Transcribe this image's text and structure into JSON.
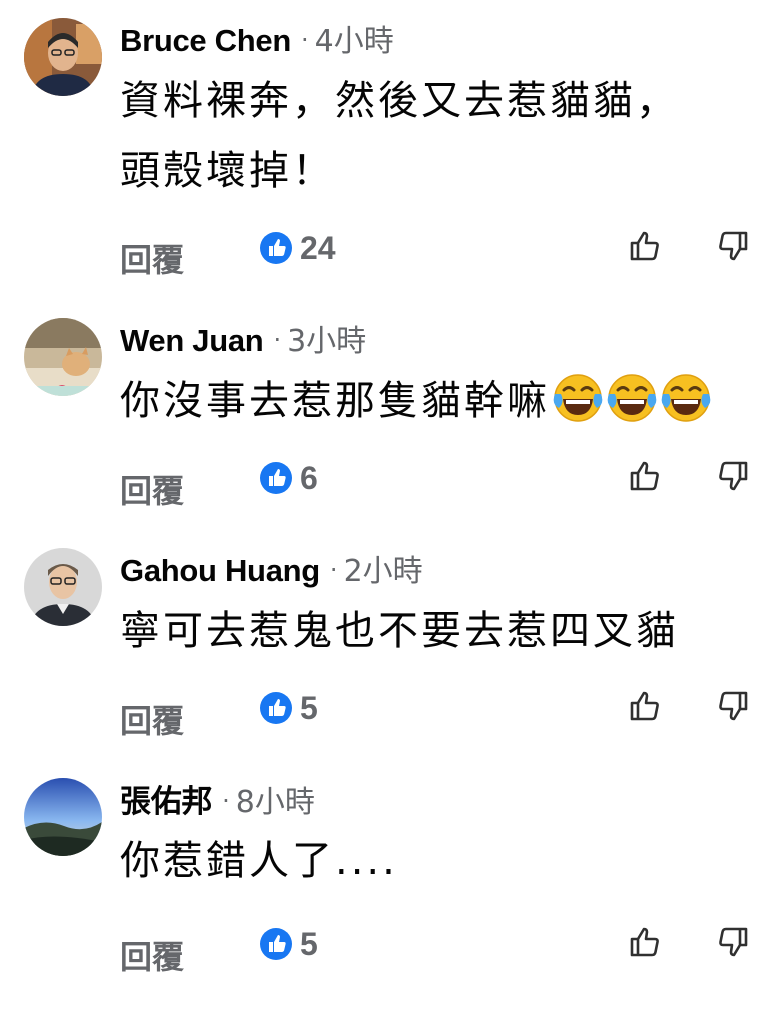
{
  "comments": [
    {
      "author": "Bruce Chen",
      "time": "4小時",
      "lines": [
        "資料裸奔，然後又去惹貓貓，",
        "頭殼壞掉！"
      ],
      "reply_label": "回覆",
      "likes": "24"
    },
    {
      "author": "Wen Juan",
      "time": "3小時",
      "lines": [
        "你沒事去惹那隻貓幹嘛"
      ],
      "emoji": [
        "face-with-tears-of-joy-icon",
        "face-with-tears-of-joy-icon",
        "face-with-tears-of-joy-icon"
      ],
      "reply_label": "回覆",
      "likes": "6"
    },
    {
      "author": "Gahou Huang",
      "time": "2小時",
      "lines": [
        "寧可去惹鬼也不要去惹四叉貓"
      ],
      "reply_label": "回覆",
      "likes": "5"
    },
    {
      "author": "張佑邦",
      "time": "8小時",
      "lines": [
        "你惹錯人了...."
      ],
      "reply_label": "回覆",
      "likes": "5"
    }
  ],
  "separator": "·",
  "colors": {
    "like_blue": "#1877f2",
    "secondary_text": "#65676b",
    "primary_text": "#050505"
  },
  "icons": {
    "like_badge": "thumbs-up-badge-icon",
    "like_button": "thumb-up-icon",
    "dislike_button": "thumb-down-icon"
  }
}
